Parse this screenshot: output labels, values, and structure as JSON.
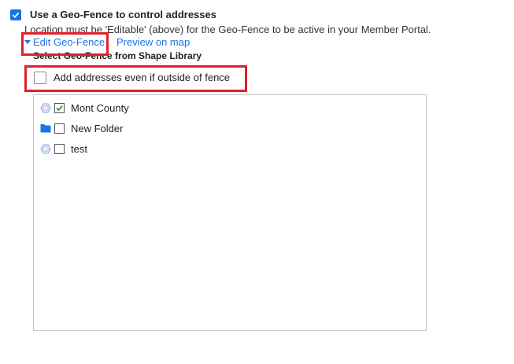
{
  "geofence": {
    "use_checkbox_checked": true,
    "use_label": "Use a Geo-Fence to control addresses",
    "note": "Location must be 'Editable' (above) for the Geo-Fence to be active in your Member Portal.",
    "edit_link": "Edit Geo-Fence",
    "preview_link": "Preview on map",
    "select_label": "Select Geo-Fence from Shape Library",
    "outside_checkbox_checked": false,
    "outside_label": "Add addresses even if outside of fence"
  },
  "tree": {
    "items": [
      {
        "icon": "polygon-shape-icon",
        "checked": true,
        "label": "Mont County"
      },
      {
        "icon": "folder-icon",
        "checked": false,
        "label": "New Folder"
      },
      {
        "icon": "polygon-shape-icon",
        "checked": false,
        "label": "test"
      }
    ]
  },
  "colors": {
    "accent": "#1a73e8",
    "highlight": "#e2202b",
    "check_green": "#2e7d32"
  }
}
